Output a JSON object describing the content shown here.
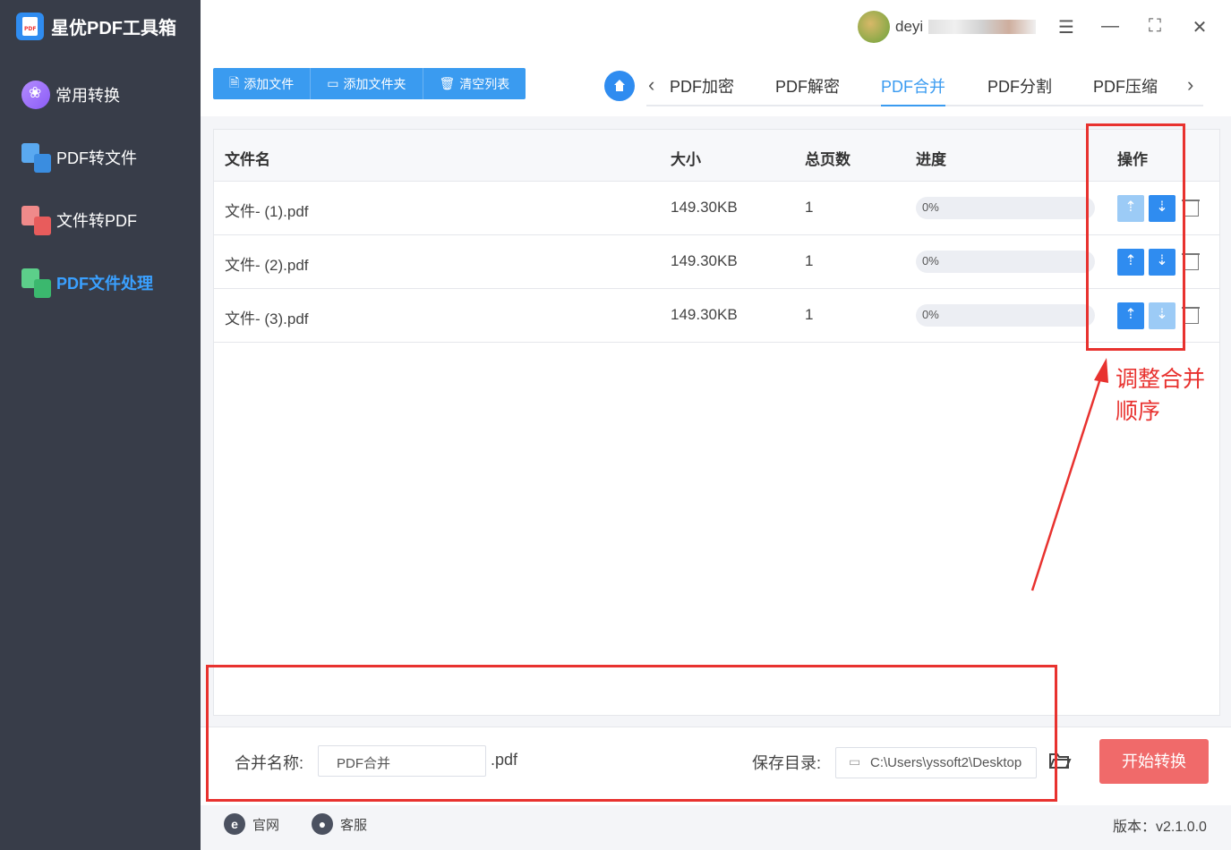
{
  "app": {
    "title": "星优PDF工具箱"
  },
  "sidebar": {
    "items": [
      {
        "label": "常用转换"
      },
      {
        "label": "PDF转文件"
      },
      {
        "label": "文件转PDF"
      },
      {
        "label": "PDF文件处理"
      }
    ]
  },
  "user": {
    "name": "deyi"
  },
  "toolbar": {
    "add_file": "添加文件",
    "add_folder": "添加文件夹",
    "clear_list": "清空列表"
  },
  "tabs": [
    {
      "label": "PDF加密"
    },
    {
      "label": "PDF解密"
    },
    {
      "label": "PDF合并"
    },
    {
      "label": "PDF分割"
    },
    {
      "label": "PDF压缩"
    }
  ],
  "table": {
    "headers": {
      "name": "文件名",
      "size": "大小",
      "pages": "总页数",
      "progress": "进度",
      "ops": "操作"
    },
    "rows": [
      {
        "name": "文件- (1).pdf",
        "size": "149.30KB",
        "pages": "1",
        "progress": "0%"
      },
      {
        "name": "文件- (2).pdf",
        "size": "149.30KB",
        "pages": "1",
        "progress": "0%"
      },
      {
        "name": "文件- (3).pdf",
        "size": "149.30KB",
        "pages": "1",
        "progress": "0%"
      }
    ]
  },
  "annotation": {
    "line1": "调整合并",
    "line2": "顺序"
  },
  "bottom": {
    "merge_name_label": "合并名称:",
    "merge_name_value": "PDF合并",
    "ext": ".pdf",
    "save_dir_label": "保存目录:",
    "save_dir_value": "C:\\Users\\yssoft2\\Desktop",
    "start_button": "开始转换"
  },
  "footer": {
    "website": "官网",
    "support": "客服",
    "version": "版本：v2.1.0.0"
  },
  "colors": {
    "accent": "#3a9bf0",
    "danger": "#f06a6a",
    "annotation": "#e8322f",
    "sidebar": "#383d49"
  }
}
